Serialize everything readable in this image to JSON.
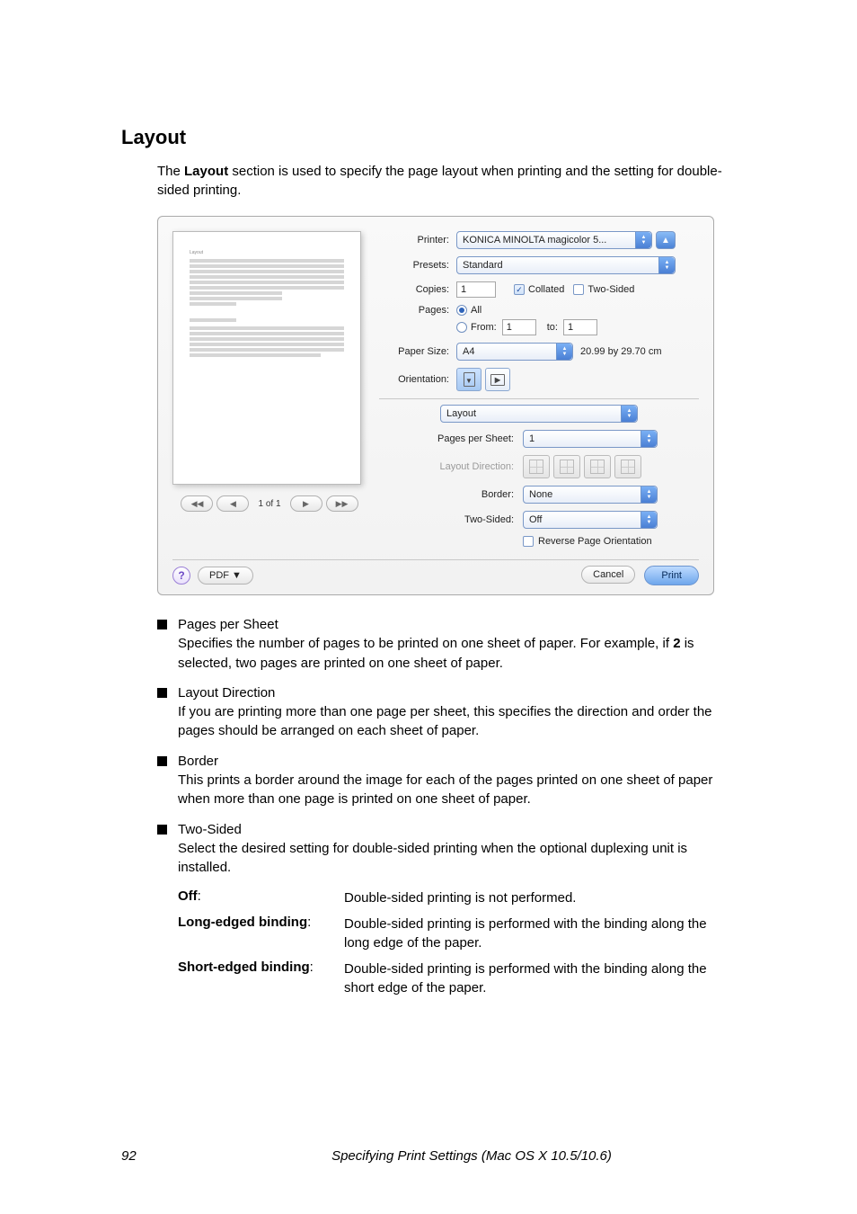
{
  "heading": "Layout",
  "intro": "The Layout section is used to specify the page layout when printing and the setting for double-sided printing.",
  "dialog": {
    "printer_lbl": "Printer:",
    "printer_val": "KONICA MINOLTA magicolor 5...",
    "presets_lbl": "Presets:",
    "presets_val": "Standard",
    "copies_lbl": "Copies:",
    "copies_val": "1",
    "collated": "Collated",
    "two_sided_chk": "Two-Sided",
    "pages_lbl": "Pages:",
    "all": "All",
    "from": "From:",
    "from_val": "1",
    "to": "to:",
    "to_val": "1",
    "papersize_lbl": "Paper Size:",
    "papersize_val": "A4",
    "paper_dims": "20.99 by 29.70 cm",
    "orientation_lbl": "Orientation:",
    "section_val": "Layout",
    "pps_lbl": "Pages per Sheet:",
    "pps_val": "1",
    "ld_lbl": "Layout Direction:",
    "border_lbl": "Border:",
    "border_val": "None",
    "ts_lbl": "Two-Sided:",
    "ts_val": "Off",
    "rpo": "Reverse Page Orientation",
    "pdf_btn": "PDF ▼",
    "cancel": "Cancel",
    "print": "Print",
    "pager": "1 of 1"
  },
  "bullets": {
    "pps_t": "Pages per Sheet",
    "pps_d": "Specifies the number of pages to be printed on one sheet of paper. For example, if 2 is selected, two pages are printed on one sheet of paper.",
    "ld_t": "Layout Direction",
    "ld_d": "If you are printing more than one page per sheet, this specifies the direction and order the pages should be arranged on each sheet of paper.",
    "b_t": "Border",
    "b_d": "This prints a border around the image for each of the pages printed on one sheet of paper when more than one page is printed on one sheet of paper.",
    "ts_t": "Two-Sided",
    "ts_d": "Select the desired setting for double-sided printing when the optional duplexing unit is installed."
  },
  "defs": {
    "off_t": "Off:",
    "off_d": "Double-sided printing is not performed.",
    "long_t": "Long-edged binding:",
    "long_d": "Double-sided printing is performed with the binding along the long edge of the paper.",
    "short_t": "Short-edged binding:",
    "short_d": "Double-sided printing is performed with the binding along the short edge of the paper."
  },
  "footer": {
    "page": "92",
    "title": "Specifying Print Settings (Mac OS X 10.5/10.6)"
  }
}
